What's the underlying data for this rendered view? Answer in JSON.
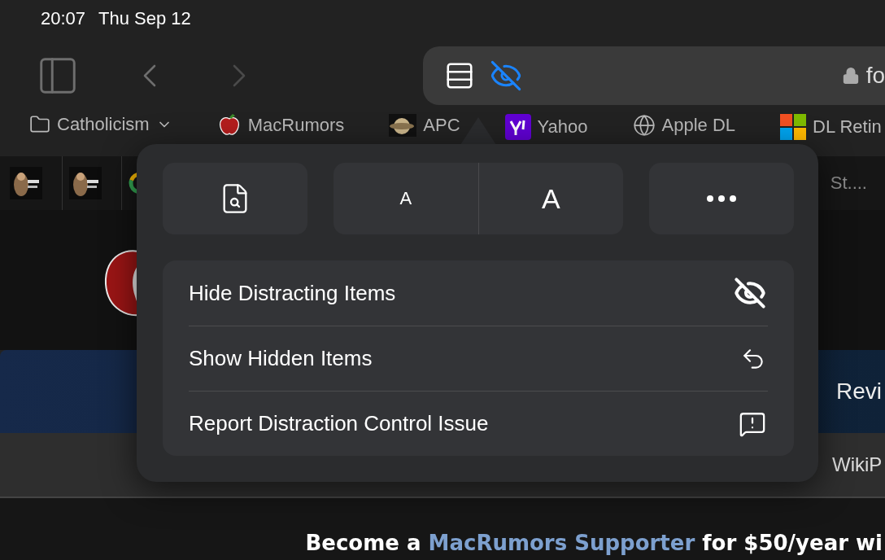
{
  "status_bar": {
    "time": "20:07",
    "date": "Thu Sep 12"
  },
  "toolbar": {
    "address": "fo",
    "distraction_control_on": true
  },
  "bookmarks": [
    {
      "kind": "folder",
      "label": "Catholicism"
    },
    {
      "kind": "apple",
      "label": "MacRumors"
    },
    {
      "label": "APC"
    },
    {
      "kind": "yahoo",
      "label": "Yahoo"
    },
    {
      "kind": "globe",
      "label": "Apple DL"
    },
    {
      "kind": "windows",
      "label": "DL Retin"
    }
  ],
  "favorites": {
    "tiles": [
      {
        "kind": "picture"
      },
      {
        "kind": "picture"
      },
      {
        "kind": "google"
      }
    ],
    "trailing": "St...."
  },
  "page": {
    "nav_tab": "Revi",
    "subnav_tab": "WikiP",
    "banner": {
      "before": "Become a",
      "link": "MacRumors Supporter",
      "after": "for $50/year wi"
    }
  },
  "popover": {
    "tools": [
      {
        "kind": "reader"
      },
      {
        "kind": "smaller",
        "label": "A"
      },
      {
        "kind": "larger",
        "label": "A"
      },
      {
        "kind": "more"
      }
    ],
    "menu": [
      {
        "kind": "hide",
        "label": "Hide Distracting Items"
      },
      {
        "kind": "show",
        "label": "Show Hidden Items"
      },
      {
        "kind": "report",
        "label": "Report Distraction Control Issue"
      }
    ]
  }
}
